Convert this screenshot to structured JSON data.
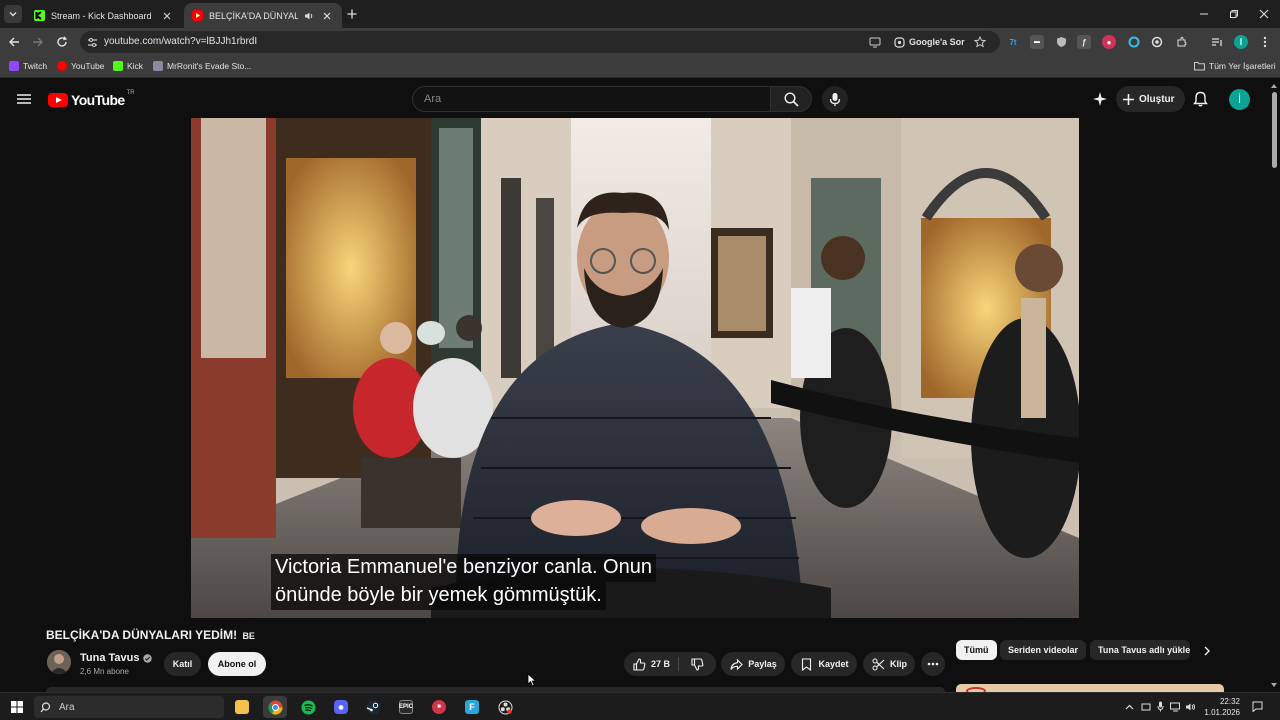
{
  "browser": {
    "tabs": [
      {
        "title": "Stream - Kick Dashboard",
        "favicon": "kick-icon",
        "active": false
      },
      {
        "title": "BELÇİKA'DA DÜNYALARI YE",
        "favicon": "youtube-icon",
        "active": true
      }
    ],
    "url": "youtube.com/watch?v=lBJJh1rbrdI",
    "google_lens_label": "Google'a Sor",
    "bookmarks": [
      {
        "label": "Twitch",
        "icon": "twitch-icon",
        "color": "#9146ff"
      },
      {
        "label": "YouTube",
        "icon": "youtube-icon",
        "color": "#ff0000"
      },
      {
        "label": "Kick",
        "icon": "kick-icon",
        "color": "#53fc18"
      },
      {
        "label": "MrRonit's Evade Sto...",
        "icon": "shield-icon",
        "color": "#8a8aa0"
      }
    ],
    "all_bookmarks_label": "Tüm Yer İşaretleri"
  },
  "youtube": {
    "logo_text": "YouTube",
    "country_code": "TR",
    "search_placeholder": "Ara",
    "create_label": "Oluştur",
    "avatar_letter": "İ",
    "avatar_color": "#0aa394"
  },
  "video": {
    "subtitle_line1": "Victoria Emmanuel'e benziyor canla. Onun",
    "subtitle_line2": "önünde böyle bir yemek gömmüştük.",
    "title": "BELÇİKA'DA DÜNYALARI YEDİM!",
    "title_flag": "BE",
    "channel_name": "Tuna Tavus",
    "subscriber_count": "2,6 Mn abone",
    "join_label": "Katıl",
    "subscribe_label": "Abone ol",
    "like_count": "27 B",
    "share_label": "Paylaş",
    "save_label": "Kaydet",
    "clip_label": "Klip"
  },
  "chips": {
    "all": "Tümü",
    "series": "Seriden videolar",
    "channel": "Tuna Tavus adlı yükle"
  },
  "taskbar": {
    "search_placeholder": "Ara",
    "time": "22:32",
    "date": "1.01.2026",
    "apps": [
      "file-explorer-icon",
      "chrome-icon",
      "spotify-icon",
      "discord-icon",
      "steam-icon",
      "epic-games-icon",
      "app-red-icon",
      "app-blue-icon",
      "obs-icon"
    ]
  }
}
